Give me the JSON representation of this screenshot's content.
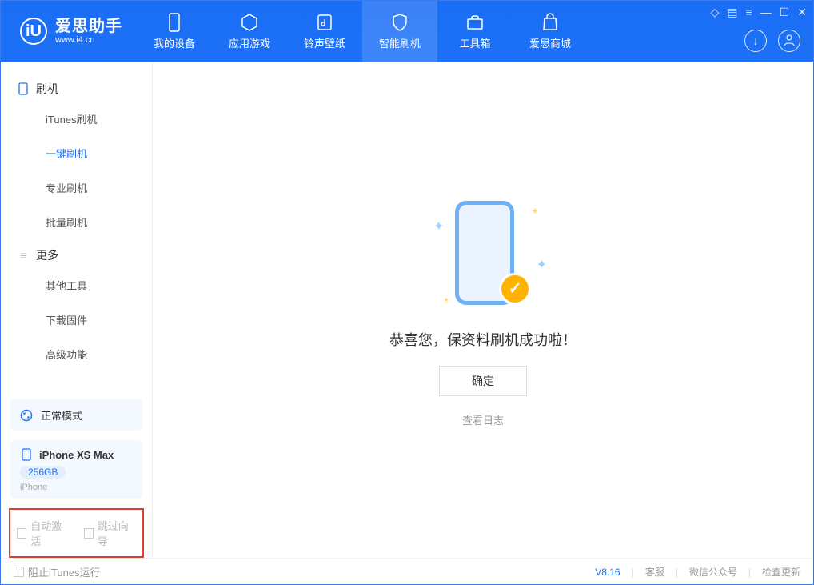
{
  "app": {
    "title": "爱思助手",
    "subtitle": "www.i4.cn",
    "logo_letter": "iU"
  },
  "tabs": {
    "device": "我的设备",
    "apps": "应用游戏",
    "ringtone": "铃声壁纸",
    "flash": "智能刷机",
    "tools": "工具箱",
    "store": "爱思商城"
  },
  "sidebar": {
    "groups": {
      "flash": {
        "label": "刷机"
      },
      "more": {
        "label": "更多"
      }
    },
    "items": {
      "itunes_flash": "iTunes刷机",
      "one_key_flash": "一键刷机",
      "pro_flash": "专业刷机",
      "batch_flash": "批量刷机",
      "other_tools": "其他工具",
      "download_fw": "下载固件",
      "advanced": "高级功能"
    },
    "status": {
      "label": "正常模式"
    },
    "device": {
      "name": "iPhone XS Max",
      "capacity": "256GB",
      "type": "iPhone"
    },
    "checks": {
      "auto_activate": "自动激活",
      "skip_guide": "跳过向导"
    }
  },
  "main": {
    "message": "恭喜您，保资料刷机成功啦！",
    "ok": "确定",
    "view_log": "查看日志"
  },
  "footer": {
    "block_itunes": "阻止iTunes运行",
    "version": "V8.16",
    "support": "客服",
    "wechat": "微信公众号",
    "update": "检查更新"
  }
}
